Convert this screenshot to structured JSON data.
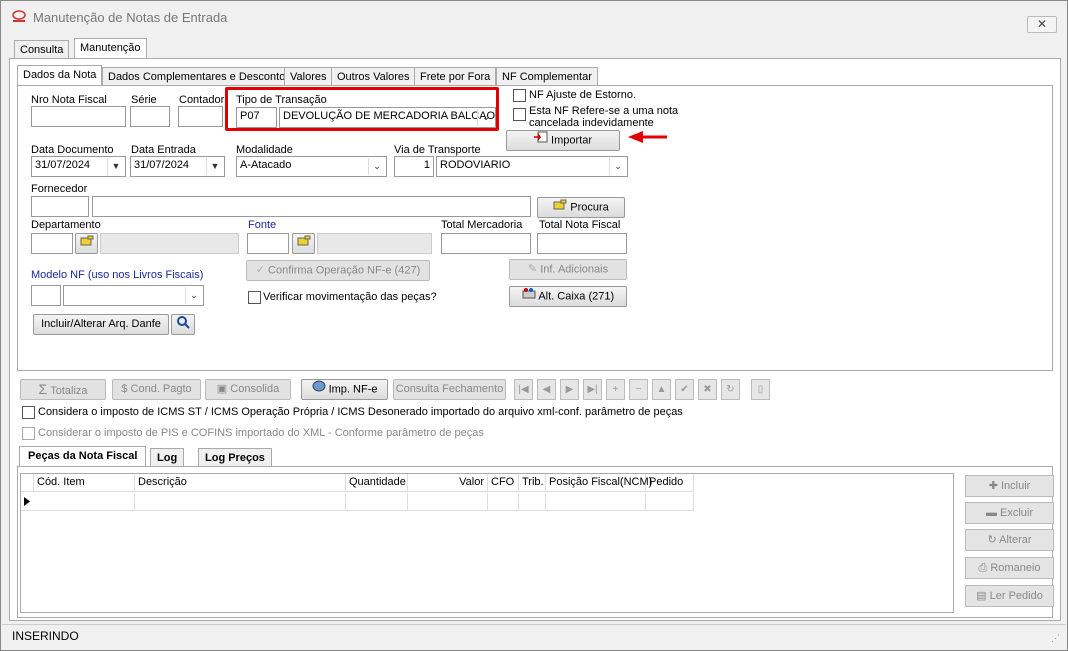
{
  "window": {
    "title": "Manutenção de Notas de Entrada",
    "close_label": "✕"
  },
  "main_tabs": [
    "Consulta",
    "Manutenção"
  ],
  "sub_tabs": [
    "Dados da Nota",
    "Dados Complementares e Desconto",
    "Valores",
    "Outros Valores",
    "Frete por Fora",
    "NF Complementar"
  ],
  "form": {
    "nro_nota_label": "Nro Nota Fiscal",
    "serie_label": "Série",
    "contador_label": "Contador",
    "tipo_transacao_label": "Tipo de Transação",
    "tipo_transacao_code": "P07",
    "tipo_transacao_value": "DEVOLUÇÃO DE MERCADORIA BALCAO",
    "nf_ajuste_label": "NF Ajuste  de Estorno.",
    "nf_refere_label1": "Esta NF Refere-se a uma nota",
    "nf_refere_label2": "cancelada indevidamente",
    "importar_label": "Importar",
    "data_documento_label": "Data Documento",
    "data_documento_value": "31/07/2024",
    "data_entrada_label": "Data Entrada",
    "data_entrada_value": "31/07/2024",
    "modalidade_label": "Modalidade",
    "modalidade_value": "A-Atacado",
    "via_transporte_label": "Via de Transporte",
    "via_transporte_code": "1",
    "via_transporte_value": "RODOVIARIO",
    "fornecedor_label": "Fornecedor",
    "procura_label": "Procura",
    "departamento_label": "Departamento",
    "fonte_label": "Fonte",
    "total_mercadoria_label": "Total Mercadoria",
    "total_nf_label": "Total Nota Fiscal",
    "modelo_nf_label": "Modelo NF (uso nos Livros Fiscais)",
    "confirma_label": "Confirma Operação NF-e (427)",
    "inf_adicionais_label": "Inf. Adicionais",
    "verificar_label": "Verificar movimentação das peças?",
    "alt_caixa_label": "Alt. Caixa (271)",
    "incluir_danfe_label": "Incluir/Alterar Arq. Danfe"
  },
  "toolbar": {
    "totaliza": "Totaliza",
    "cond_pagto": "Cond. Pagto",
    "consolida": "Consolida",
    "imp_nfe": "Imp. NF-e",
    "consulta_fechamento": "Consulta Fechamento",
    "nav": [
      "|◀",
      "◀",
      "▶",
      "▶|",
      "+",
      "−",
      "▲",
      "✔",
      "✖",
      "↻"
    ]
  },
  "options": {
    "icms_label": "Considera o imposto de ICMS ST / ICMS Operação Própria / ICMS Desonerado importado do arquivo xml-conf. parâmetro de peças",
    "pis_label": "Considerar o imposto de PIS e COFINS importado do XML - Conforme parâmetro de peças"
  },
  "bottom_tabs": [
    "Peças da Nota Fiscal",
    "Log",
    "Log Preços"
  ],
  "grid": {
    "columns": [
      "Cód. Item",
      "Descrição",
      "Quantidade",
      "Valor",
      "CFO",
      "Trib.",
      "Posição Fiscal(NCM)",
      "Pedido"
    ]
  },
  "side_buttons": [
    "Incluir",
    "Excluir",
    "Alterar",
    "Romaneio",
    "Ler Pedido"
  ],
  "status": {
    "text": "INSERINDO"
  },
  "colors": {
    "highlight": "#e00000",
    "label_blue": "#1a2a9a"
  }
}
